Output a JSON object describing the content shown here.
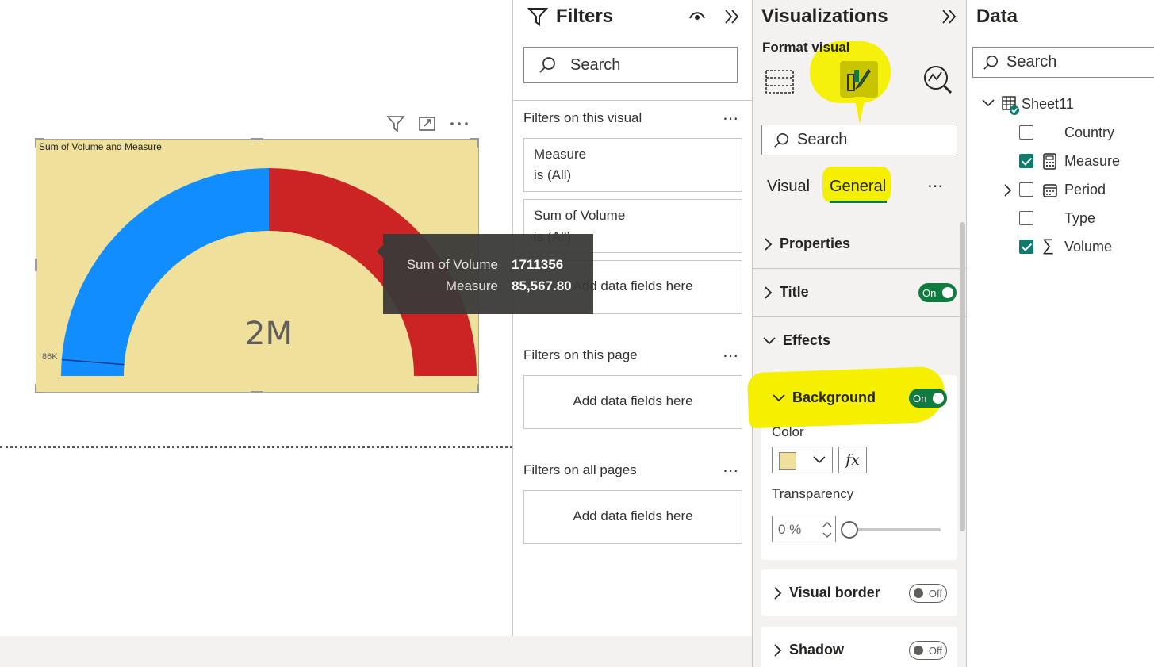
{
  "visual": {
    "title": "Sum of Volume and Measure",
    "gauge_center_label": "2M",
    "target_label": "86K",
    "gauge_value": 1711356,
    "gauge_max": 3422712,
    "target_value": 85567.8,
    "colors": {
      "fill": "#118dff",
      "remaining": "#cc2424",
      "background": "#efe09b",
      "target_line": "#1a3a8a"
    }
  },
  "tooltip": {
    "rows": [
      {
        "label": "Sum of Volume",
        "value": "1711356"
      },
      {
        "label": "Measure",
        "value": "85,567.80"
      }
    ]
  },
  "filters": {
    "title": "Filters",
    "search_placeholder": "Search",
    "on_visual": {
      "label": "Filters on this visual",
      "cards": [
        {
          "line1": "Measure",
          "line2": "is (All)"
        },
        {
          "line1": "Sum of Volume",
          "line2": "is (All)"
        }
      ],
      "add_label": "Add data fields here"
    },
    "on_page": {
      "label": "Filters on this page",
      "add_label": "Add data fields here"
    },
    "on_all_pages": {
      "label": "Filters on all pages",
      "add_label": "Add data fields here"
    }
  },
  "visualizations": {
    "title": "Visualizations",
    "format_visual_label": "Format visual",
    "search_placeholder": "Search",
    "tabs": [
      "Visual",
      "General"
    ],
    "active_tab": "General",
    "sections": {
      "properties": "Properties",
      "title": "Title",
      "title_toggle": "On",
      "effects": "Effects",
      "background": "Background",
      "background_toggle": "On",
      "color_label": "Color",
      "color_value": "#efe09b",
      "fx_label": "fx",
      "transparency_label": "Transparency",
      "transparency_value": "0 %",
      "transparency_fraction": 0,
      "visual_border": "Visual border",
      "visual_border_toggle": "Off",
      "shadow": "Shadow",
      "shadow_toggle": "Off"
    },
    "highlight_color": "#f5ef00"
  },
  "data": {
    "title": "Data",
    "search_placeholder": "Search",
    "table": "Sheet11",
    "fields": [
      {
        "name": "Country",
        "checked": false,
        "icon": "none",
        "expandable": false
      },
      {
        "name": "Measure",
        "checked": true,
        "icon": "calculator-icon",
        "expandable": false
      },
      {
        "name": "Period",
        "checked": false,
        "icon": "calendar-icon",
        "expandable": true
      },
      {
        "name": "Type",
        "checked": false,
        "icon": "none",
        "expandable": false
      },
      {
        "name": "Volume",
        "checked": true,
        "icon": "sigma-icon",
        "expandable": false
      }
    ]
  }
}
